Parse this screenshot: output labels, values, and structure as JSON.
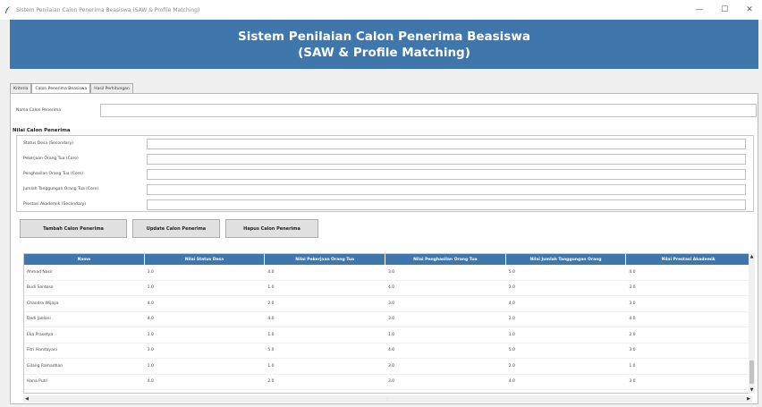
{
  "window": {
    "title": "Sistem Penilaian Calon Penerima Beasiswa (SAW & Profile Matching)",
    "minimize": "—",
    "maximize": "☐",
    "close": "✕"
  },
  "header": {
    "line1": "Sistem Penilaian Calon Penerima Beasiswa",
    "line2": "(SAW & Profile Matching)"
  },
  "tabs": [
    {
      "label": "Kriteria",
      "active": false
    },
    {
      "label": "Calon Penerima Beasiswa",
      "active": true
    },
    {
      "label": "Hasil Perhitungan",
      "active": false
    }
  ],
  "form": {
    "nama_label": "Nama Calon Penerima",
    "nama_value": "",
    "section_title": "Nilai Calon Penerima",
    "criteria": [
      {
        "label": "Status Desa (Secondary)",
        "value": ""
      },
      {
        "label": "Pekerjaan Orang Tua (Core)",
        "value": ""
      },
      {
        "label": "Penghasilan Orang Tua (Core)",
        "value": ""
      },
      {
        "label": "Jumlah Tanggungan Orang Tua (Core)",
        "value": ""
      },
      {
        "label": "Prestasi Akademik (Secondary)",
        "value": ""
      }
    ]
  },
  "buttons": {
    "add": "Tambah Calon Penerima",
    "update": "Update Calon Penerima",
    "delete": "Hapus Calon Penerima"
  },
  "table": {
    "columns": [
      "Nama",
      "Nilai Status Desa",
      "Nilai Pekerjaan Orang Tua",
      "Nilai Penghasilan Orang Tua",
      "Nilai Jumlah Tanggungan Orang",
      "Nilai Prestasi Akademik"
    ],
    "rows": [
      [
        "Ahmad Nasir",
        "3.0",
        "4.0",
        "3.0",
        "5.0",
        "4.0"
      ],
      [
        "Budi Santoso",
        "1.0",
        "1.0",
        "4.0",
        "3.0",
        "3.0"
      ],
      [
        "Chandra Wijaya",
        "4.0",
        "2.0",
        "3.0",
        "4.0",
        "3.0"
      ],
      [
        "Dedi Jaelani",
        "4.0",
        "4.0",
        "3.0",
        "2.0",
        "4.0"
      ],
      [
        "Eka Prasetya",
        "1.0",
        "1.0",
        "1.0",
        "1.0",
        "2.0"
      ],
      [
        "Fitri Handayani",
        "3.0",
        "5.0",
        "4.0",
        "5.0",
        "3.0"
      ],
      [
        "Gilang Ramadhan",
        "1.0",
        "1.0",
        "3.0",
        "2.0",
        "1.0"
      ],
      [
        "Hana Putri",
        "4.0",
        "2.0",
        "3.0",
        "4.0",
        "3.0"
      ]
    ]
  },
  "colors": {
    "header_bg": "#3f77ad",
    "table_header_bg": "#3f77ad",
    "panel_bg": "#ffffff",
    "window_bg": "#f0f0f0"
  }
}
